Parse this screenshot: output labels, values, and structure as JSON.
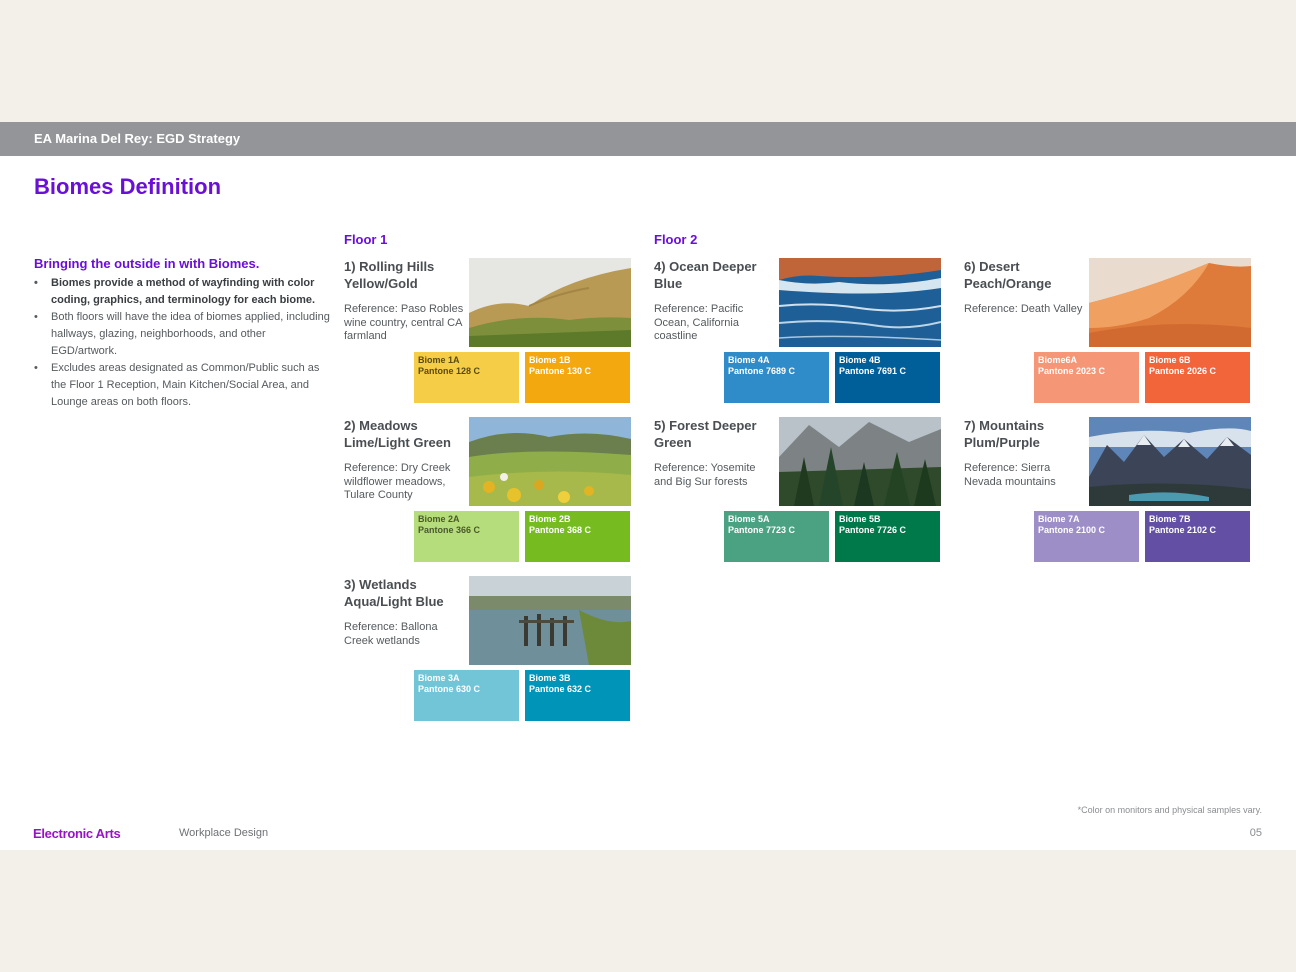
{
  "header": {
    "title": "EA Marina Del Rey: EGD Strategy"
  },
  "page_title": "Biomes Definition",
  "intro": {
    "heading": "Bringing the outside in with Biomes.",
    "bullets": [
      "Biomes provide a method of wayfinding with color coding, graphics, and terminology for each biome.",
      "Both floors will have the idea of biomes applied, including hallways, glazing, neighborhoods, and other EGD/artwork.",
      "Excludes areas designated as Common/Public such as the Floor 1 Reception, Main Kitchen/Social Area, and Lounge areas on both floors."
    ]
  },
  "floors": {
    "floor1": "Floor 1",
    "floor2": "Floor 2"
  },
  "biomes": [
    {
      "title": "1) Rolling Hills Yellow/Gold",
      "reference": "Reference: Paso Robles wine country, central CA farmland",
      "photo": "rolling-hills-photo",
      "swatches": [
        {
          "name": "Biome 1A",
          "code": "Pantone 128 C",
          "color": "#f5cd47",
          "text": "#5a4a10"
        },
        {
          "name": "Biome 1B",
          "code": "Pantone 130 C",
          "color": "#f4a80f",
          "text": "#ffffff"
        }
      ]
    },
    {
      "title": "2) Meadows Lime/Light Green",
      "reference": "Reference: Dry Creek wildflower meadows, Tulare County",
      "photo": "meadows-photo",
      "swatches": [
        {
          "name": "Biome 2A",
          "code": "Pantone 366 C",
          "color": "#b6dd7c",
          "text": "#4a5a2a"
        },
        {
          "name": "Biome 2B",
          "code": "Pantone 368 C",
          "color": "#76bc21",
          "text": "#ffffff"
        }
      ]
    },
    {
      "title": "3) Wetlands Aqua/Light Blue",
      "reference": "Reference: Ballona Creek wetlands",
      "photo": "wetlands-photo",
      "swatches": [
        {
          "name": "Biome 3A",
          "code": "Pantone 630 C",
          "color": "#72c5d7",
          "text": "#ffffff"
        },
        {
          "name": "Biome 3B",
          "code": "Pantone 632 C",
          "color": "#0094b9",
          "text": "#ffffff"
        }
      ]
    },
    {
      "title": "4) Ocean Deeper Blue",
      "reference": "Reference: Pacific Ocean, California coastline",
      "photo": "ocean-photo",
      "swatches": [
        {
          "name": "Biome 4A",
          "code": "Pantone 7689 C",
          "color": "#2f8cc8",
          "text": "#ffffff"
        },
        {
          "name": "Biome 4B",
          "code": "Pantone 7691 C",
          "color": "#005e99",
          "text": "#ffffff"
        }
      ]
    },
    {
      "title": "5) Forest Deeper Green",
      "reference": "Reference: Yosemite and Big Sur forests",
      "photo": "forest-photo",
      "swatches": [
        {
          "name": "Biome 5A",
          "code": "Pantone 7723 C",
          "color": "#4aa283",
          "text": "#ffffff"
        },
        {
          "name": "Biome 5B",
          "code": "Pantone 7726 C",
          "color": "#00794a",
          "text": "#ffffff"
        }
      ]
    },
    {
      "title": "6) Desert Peach/Orange",
      "reference": "Reference: Death Valley",
      "photo": "desert-photo",
      "swatches": [
        {
          "name": "Biome6A",
          "code": "Pantone 2023 C",
          "color": "#f59677",
          "text": "#ffffff"
        },
        {
          "name": "Biome 6B",
          "code": "Pantone 2026 C",
          "color": "#f2643a",
          "text": "#ffffff"
        }
      ]
    },
    {
      "title": "7) Mountains Plum/Purple",
      "reference": "Reference: Sierra Nevada mountains",
      "photo": "mountains-photo",
      "swatches": [
        {
          "name": "Biome 7A",
          "code": "Pantone 2100 C",
          "color": "#9d8ec7",
          "text": "#ffffff"
        },
        {
          "name": "Biome 7B",
          "code": "Pantone 2102 C",
          "color": "#6350a4",
          "text": "#ffffff"
        }
      ]
    }
  ],
  "footer": {
    "note": "*Color on monitors and physical samples vary.",
    "brand": "Electronic Arts",
    "department": "Workplace Design",
    "page": "05"
  },
  "colors": {
    "accent": "#6a0fd6",
    "header_bar": "#939598",
    "brand": "#9a12c8"
  }
}
